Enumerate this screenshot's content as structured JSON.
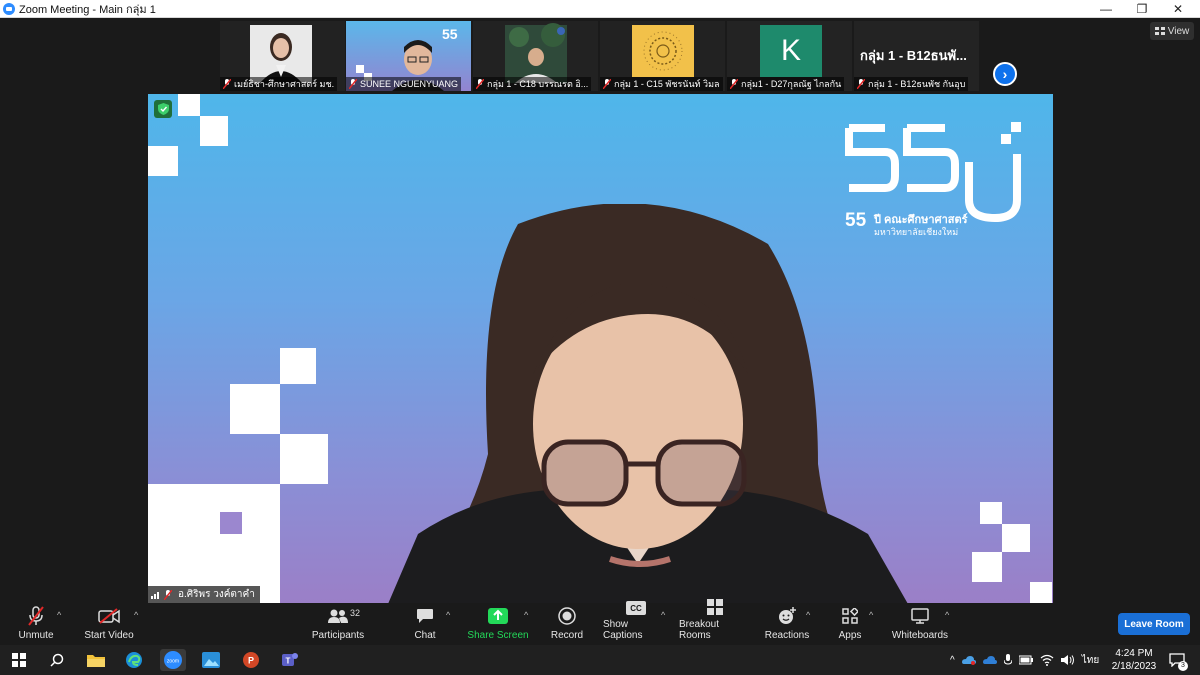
{
  "window": {
    "title": "Zoom Meeting - Main กลุ่ม 1",
    "minimize": "—",
    "restore": "❐",
    "close": "✕"
  },
  "view_button": {
    "label": "View"
  },
  "participants_strip": [
    {
      "name": "เมย์ธิชา-ศึกษาศาสตร์ มช.",
      "muted": true
    },
    {
      "name": "SUNEE NGUENYUANG",
      "muted": true
    },
    {
      "name": "กลุ่ม 1 - C18 บรรณรต อิ...",
      "muted": true
    },
    {
      "name": "กลุ่ม 1 - C15 พัชรนันท์ วิมล",
      "muted": true
    },
    {
      "name": "กลุ่ม1 - D27กุลณัฐ ไกลกัน",
      "muted": true,
      "avatar_letter": "K"
    },
    {
      "name": "กลุ่ม 1 - B12ธนพัช กันอุบ",
      "muted": true,
      "tile_title": "กลุ่ม 1 - B12ธนพั..."
    }
  ],
  "main_video": {
    "logo_number": "55",
    "logo_suffix": "ปี",
    "logo_line1": "คณะศึกษาศาสตร์",
    "logo_line2": "มหาวิทยาลัยเชียงใหม่",
    "speaker_name": "อ.ศิริพร วงค์ตาคำ",
    "accent_color": "#4fb6ea"
  },
  "toolbar": {
    "unmute": "Unmute",
    "start_video": "Start Video",
    "participants": "Participants",
    "participants_count": "32",
    "chat": "Chat",
    "share_screen": "Share Screen",
    "record": "Record",
    "show_captions": "Show Captions",
    "breakout_rooms": "Breakout Rooms",
    "reactions": "Reactions",
    "apps": "Apps",
    "whiteboards": "Whiteboards",
    "leave_room": "Leave Room",
    "share_color": "#23d959",
    "leave_color": "#1a6fd6"
  },
  "taskbar": {
    "time": "4:24 PM",
    "date": "2/18/2023",
    "language": "ไทย",
    "notification_count": "3"
  }
}
